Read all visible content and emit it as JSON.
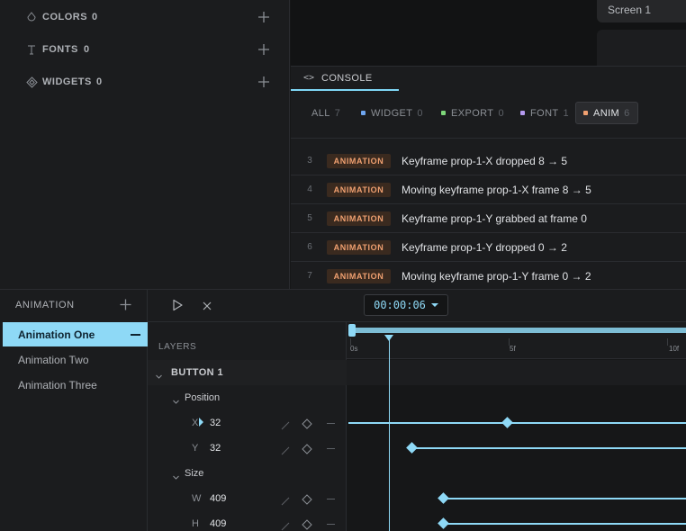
{
  "assets": {
    "rows": [
      {
        "label": "COLORS",
        "count": "0",
        "icon": "drop-icon"
      },
      {
        "label": "FONTS",
        "count": "0",
        "icon": "text-icon"
      },
      {
        "label": "WIDGETS",
        "count": "0",
        "icon": "diamond-icon"
      }
    ]
  },
  "screen": {
    "tab_label": "Screen 1"
  },
  "console": {
    "tab_label": "CONSOLE",
    "filters": [
      {
        "label": "ALL",
        "count": "7",
        "color": ""
      },
      {
        "label": "WIDGET",
        "count": "0",
        "color": "#6fa6f0"
      },
      {
        "label": "EXPORT",
        "count": "0",
        "color": "#7ed67a"
      },
      {
        "label": "FONT",
        "count": "1",
        "color": "#b59af0"
      },
      {
        "label": "ANIM",
        "count": "6",
        "color": "#f0a070"
      }
    ],
    "active_filter": "ANIM",
    "logs": [
      {
        "num": "3",
        "badge": "ANIMATION",
        "message": "Keyframe prop-1-X dropped 8 → 5"
      },
      {
        "num": "4",
        "badge": "ANIMATION",
        "message": "Moving keyframe prop-1-X frame 8 → 5"
      },
      {
        "num": "5",
        "badge": "ANIMATION",
        "message": "Keyframe prop-1-Y grabbed at frame 0"
      },
      {
        "num": "6",
        "badge": "ANIMATION",
        "message": "Keyframe prop-1-Y dropped 0 → 2"
      },
      {
        "num": "7",
        "badge": "ANIMATION",
        "message": "Moving keyframe prop-1-Y frame 0 → 2"
      }
    ]
  },
  "animation_panel": {
    "title": "ANIMATION",
    "items": [
      "Animation One",
      "Animation Two",
      "Animation Three"
    ],
    "selected": "Animation One"
  },
  "timeline": {
    "time": "00:00:06",
    "layers_header": "LAYERS",
    "ruler_labels": [
      "0s",
      "5f",
      "10f"
    ],
    "playhead_frame": 6,
    "layers": [
      {
        "type": "group",
        "name": "BUTTON 1"
      },
      {
        "type": "subgroup",
        "name": "Position"
      },
      {
        "type": "prop",
        "label": "X",
        "value": "32",
        "keyframes": [
          0,
          5
        ],
        "line_from": 0
      },
      {
        "type": "prop",
        "label": "Y",
        "value": "32",
        "keyframes": [
          2
        ],
        "line_from": 2
      },
      {
        "type": "subgroup",
        "name": "Size"
      },
      {
        "type": "prop",
        "label": "W",
        "value": "409",
        "keyframes": [
          3
        ],
        "line_from": 3
      },
      {
        "type": "prop",
        "label": "H",
        "value": "409",
        "keyframes": [
          3
        ],
        "line_from": 3
      }
    ]
  }
}
